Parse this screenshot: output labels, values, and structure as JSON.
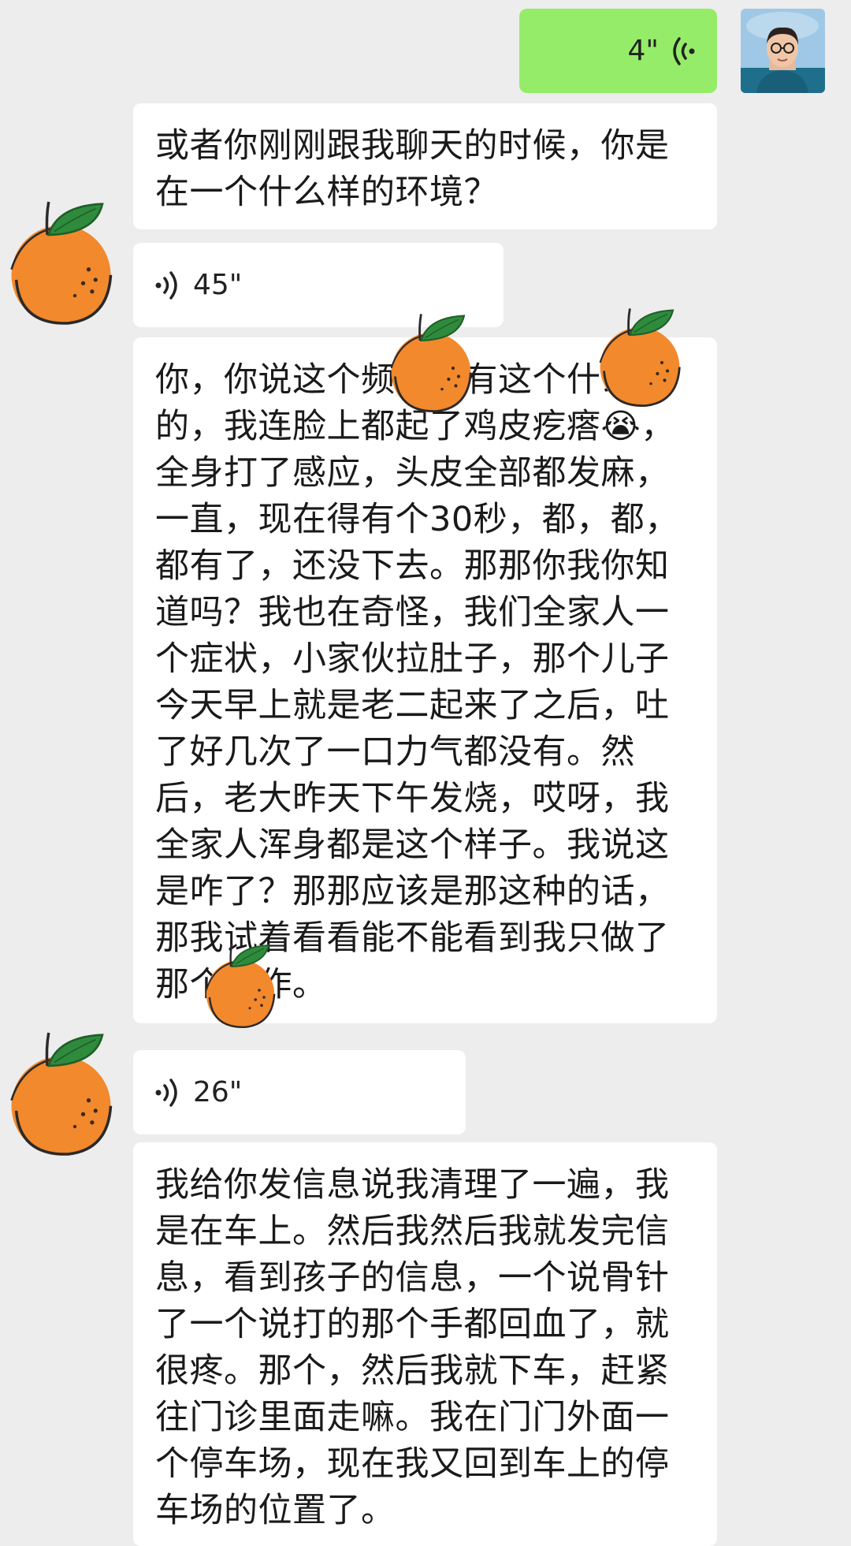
{
  "messages": [
    {
      "sender": "me",
      "type": "voice",
      "duration": "4\""
    },
    {
      "sender": "other",
      "type": "text",
      "text": "或者你刚刚跟我聊天的时候，你是在一个什么样的环境？"
    },
    {
      "sender": "other",
      "type": "voice",
      "duration": "45\""
    },
    {
      "sender": "other",
      "type": "text",
      "text": "你，你说这个频率还有这个什么的，我连脸上都起了鸡皮疙瘩😭，全身打了感应，头皮全部都发麻，一直，现在得有个30秒，都，都，都有了，还没下去。那那你我你知道吗？我也在奇怪，我们全家人一个症状，小家伙拉肚子，那个儿子今天早上就是老二起来了之后，吐了好几次了一口力气都没有。然后，老大昨天下午发烧，哎呀，我全家人浑身都是这个样子。我说这是咋了？那那应该是那这种的话，那我试着看看能不能看到我只做了那个操作。"
    },
    {
      "sender": "other",
      "type": "voice",
      "duration": "26\""
    },
    {
      "sender": "other",
      "type": "text",
      "text": "我给你发信息说我清理了一遍，我是在车上。然后我然后我就发完信息，看到孩子的信息，一个说骨针了一个说打的那个手都回血了，就很疼。那个，然后我就下车，赶紧往门诊里面走嘛。我在门门外面一个停车场，现在我又回到车上的停车场的位置了。"
    }
  ],
  "icons": {
    "voice": "voice-wave-icon",
    "sticker": "orange-sticker-icon",
    "avatar": "user-avatar"
  },
  "colors": {
    "background": "#ededed",
    "incoming_bubble": "#ffffff",
    "outgoing_bubble": "#95ec69",
    "orange": "#f08a2e",
    "leaf": "#2e8b3c"
  }
}
